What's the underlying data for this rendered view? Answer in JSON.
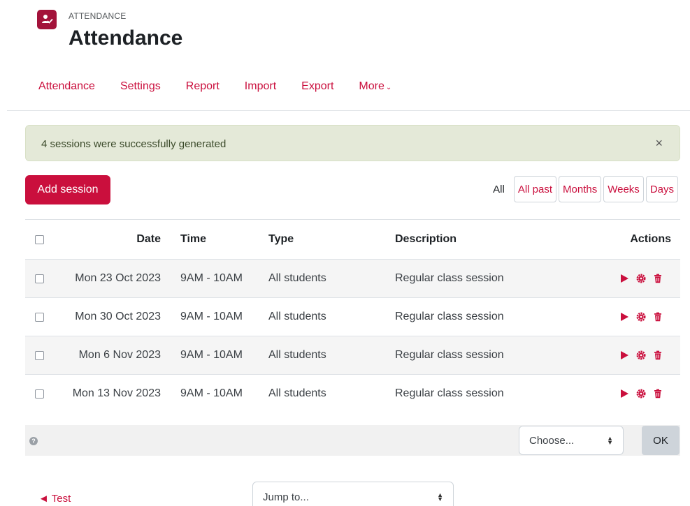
{
  "header": {
    "eyebrow": "ATTENDANCE",
    "title": "Attendance",
    "icon": "attendance-icon"
  },
  "nav": {
    "items": [
      "Attendance",
      "Settings",
      "Report",
      "Import",
      "Export"
    ],
    "more_label": "More",
    "accent": "#ca0f3d"
  },
  "alert": {
    "message": "4 sessions were successfully generated",
    "close": "×"
  },
  "toolbar": {
    "add_session_label": "Add session",
    "view_all_label": "All",
    "views": [
      "All past",
      "Months",
      "Weeks",
      "Days"
    ]
  },
  "table": {
    "headers": {
      "date": "Date",
      "time": "Time",
      "type": "Type",
      "description": "Description",
      "actions": "Actions"
    },
    "rows": [
      {
        "date": "Mon 23 Oct 2023",
        "time": "9AM - 10AM",
        "type": "All students",
        "description": "Regular class session"
      },
      {
        "date": "Mon 30 Oct 2023",
        "time": "9AM - 10AM",
        "type": "All students",
        "description": "Regular class session"
      },
      {
        "date": "Mon 6 Nov 2023",
        "time": "9AM - 10AM",
        "type": "All students",
        "description": "Regular class session"
      },
      {
        "date": "Mon 13 Nov 2023",
        "time": "9AM - 10AM",
        "type": "All students",
        "description": "Regular class session"
      }
    ]
  },
  "bulk": {
    "select_value": "Choose...",
    "ok_label": "OK",
    "help": "?"
  },
  "footer": {
    "prev_activity": "◄ Test",
    "jump_to": "Jump to..."
  }
}
